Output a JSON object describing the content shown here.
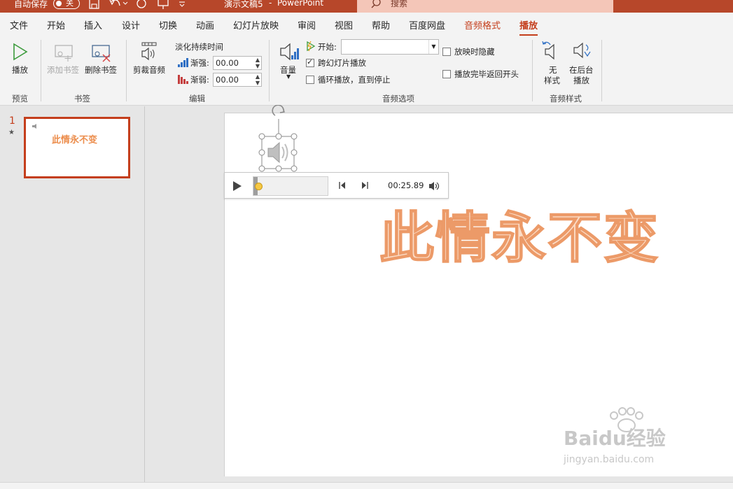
{
  "titlebar": {
    "autosave_label": "自动保存",
    "autosave_state": "关",
    "doc_title": "演示文稿5",
    "separator": "-",
    "app_name": "PowerPoint",
    "search_placeholder": "搜索"
  },
  "tabs": [
    {
      "label": "文件"
    },
    {
      "label": "开始"
    },
    {
      "label": "插入"
    },
    {
      "label": "设计"
    },
    {
      "label": "切换"
    },
    {
      "label": "动画"
    },
    {
      "label": "幻灯片放映"
    },
    {
      "label": "审阅"
    },
    {
      "label": "视图"
    },
    {
      "label": "帮助"
    },
    {
      "label": "百度网盘"
    },
    {
      "label": "音频格式"
    },
    {
      "label": "播放"
    }
  ],
  "ribbon": {
    "preview": {
      "play_label": "播放",
      "group_label": "预览"
    },
    "bookmarks": {
      "add_label": "添加书签",
      "delete_label": "删除书签",
      "group_label": "书签"
    },
    "editing": {
      "trim_label": "剪裁音频",
      "fade_title": "淡化持续时间",
      "fade_in_label": "渐强:",
      "fade_in_value": "00.00",
      "fade_out_label": "渐弱:",
      "fade_out_value": "00.00",
      "group_label": "编辑"
    },
    "audio_options": {
      "volume_label": "音量",
      "start_label": "开始:",
      "start_value": "",
      "cross_slides_label": "跨幻灯片播放",
      "cross_slides_checked": true,
      "loop_label": "循环播放，直到停止",
      "loop_checked": false,
      "hide_label": "放映时隐藏",
      "hide_checked": false,
      "rewind_label": "播放完毕返回开头",
      "rewind_checked": false,
      "group_label": "音频选项"
    },
    "audio_styles": {
      "no_style_line1": "无",
      "no_style_line2": "样式",
      "bg_play_line1": "在后台",
      "bg_play_line2": "播放",
      "group_label": "音频样式"
    }
  },
  "thumbnails": [
    {
      "number": "1",
      "star": "★",
      "text": "此情永不变"
    }
  ],
  "player": {
    "time": "00:25.89",
    "progress": 0.03
  },
  "slide": {
    "title": "此情永不变"
  },
  "watermark": {
    "brand": "Baidu经验",
    "url": "jingyan.baidu.com"
  },
  "colors": {
    "accent": "#c43e1c",
    "titlebar": "#b7472a",
    "title_fill": "#fbdcc6",
    "title_stroke": "#ec9a68"
  }
}
